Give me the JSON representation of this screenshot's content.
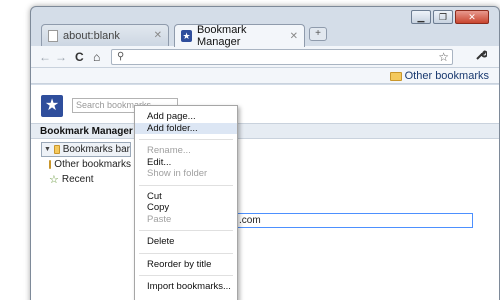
{
  "window": {
    "controls": {
      "minimize": "▁",
      "maximize": "❐",
      "close": "✕"
    }
  },
  "tabs": [
    {
      "title": "about:blank",
      "icon": "page-icon",
      "active": false
    },
    {
      "title": "Bookmark Manager",
      "icon": "star-favicon",
      "active": true
    }
  ],
  "toolbar": {
    "back": "←",
    "forward": "→",
    "reload": "C",
    "home": "⌂",
    "omnibox_value": "",
    "star": "☆",
    "wrench": "🔧"
  },
  "bookmarks_bar": {
    "other_bookmarks": "Other bookmarks"
  },
  "manager": {
    "logo": "★",
    "search_placeholder": "Search bookmarks",
    "header": "Bookmark Manager",
    "tree": {
      "root": "Bookmarks bar",
      "items": [
        "Other bookmarks",
        "Recent"
      ]
    },
    "url_value": ".com",
    "list_fragment": "a"
  },
  "context_menu": {
    "groups": [
      [
        {
          "label": "Add page...",
          "disabled": false
        },
        {
          "label": "Add folder...",
          "disabled": false,
          "hover": true
        }
      ],
      [
        {
          "label": "Rename...",
          "disabled": true
        },
        {
          "label": "Edit...",
          "disabled": false
        },
        {
          "label": "Show in folder",
          "disabled": true
        }
      ],
      [
        {
          "label": "Cut",
          "disabled": false
        },
        {
          "label": "Copy",
          "disabled": false
        },
        {
          "label": "Paste",
          "disabled": true
        }
      ],
      [
        {
          "label": "Delete",
          "disabled": false
        }
      ],
      [
        {
          "label": "Reorder by title",
          "disabled": false
        }
      ],
      [
        {
          "label": "Import bookmarks...",
          "disabled": false
        }
      ]
    ]
  }
}
